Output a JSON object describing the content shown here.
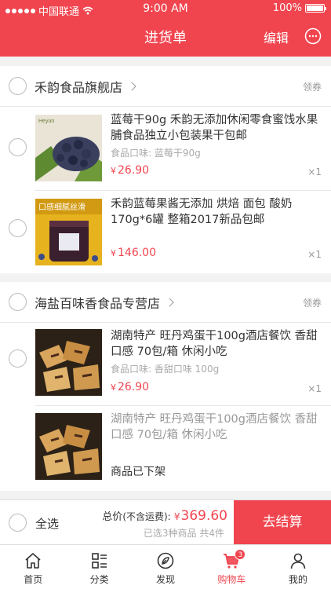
{
  "status_bar": {
    "carrier": "中国联通",
    "time": "9:00 AM",
    "battery": "100%"
  },
  "header": {
    "title": "进货单",
    "edit_label": "编辑"
  },
  "stores": [
    {
      "name": "禾韵食品旗舰店",
      "coupon": "领券",
      "items": [
        {
          "title": "蓝莓干90g 禾韵无添加休闲零食蜜饯水果脯食品独立小包装果干包邮",
          "spec": "食品口味:  蓝莓干90g",
          "currency": "¥",
          "price": "26.90",
          "qty": "×1"
        },
        {
          "title": "禾韵蓝莓果酱无添加 烘焙 面包 酸奶 170g*6罐 整箱2017新品包邮",
          "spec": "",
          "currency": "¥",
          "price": "146.00",
          "qty": "×1"
        }
      ]
    },
    {
      "name": "海盐百味香食品专营店",
      "coupon": "领券",
      "items": [
        {
          "title": "湖南特产 旺丹鸡蛋干100g酒店餐饮 香甜口感 70包/箱 休闲小吃",
          "spec": "食品口味:  香甜口味 100g",
          "currency": "¥",
          "price": "26.90",
          "qty": "×1"
        },
        {
          "title": "湖南特产 旺丹鸡蛋干100g酒店餐饮 香甜口感 70包/箱 休闲小吃",
          "status": "商品已下架"
        }
      ]
    }
  ],
  "summary": {
    "select_all": "全选",
    "total_label": "总价",
    "total_note": "(不含运费):",
    "currency": "¥",
    "total_amount": "369.60",
    "sub_text": "已选3种商品 共4件",
    "checkout_label": "去结算"
  },
  "tabbar": {
    "tabs": [
      {
        "label": "首页",
        "icon": "home-icon"
      },
      {
        "label": "分类",
        "icon": "category-icon"
      },
      {
        "label": "发现",
        "icon": "discover-icon"
      },
      {
        "label": "购物车",
        "icon": "cart-icon",
        "badge": "3",
        "active": true
      },
      {
        "label": "我的",
        "icon": "profile-icon"
      }
    ]
  },
  "colors": {
    "accent": "#f0454f",
    "background": "#f2f2f2",
    "muted_text": "#999999"
  }
}
